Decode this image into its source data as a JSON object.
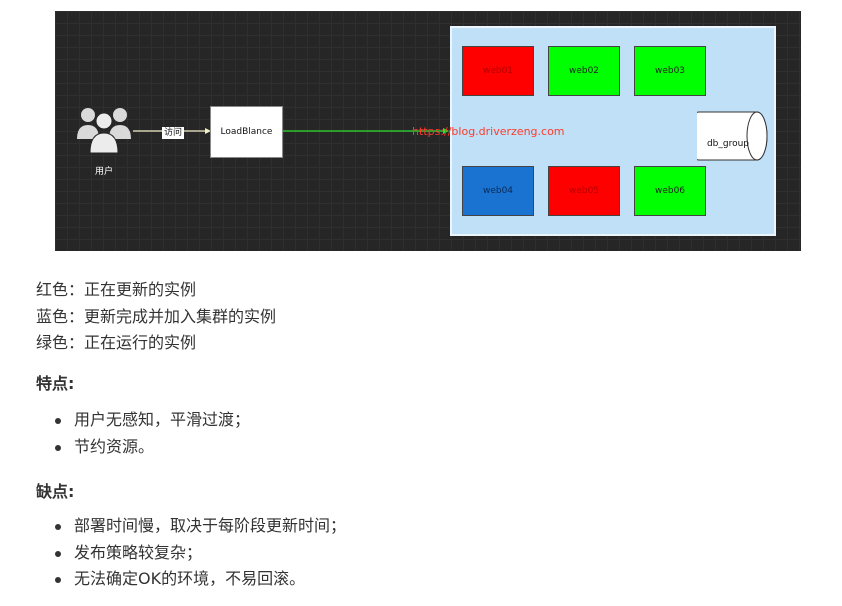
{
  "diagram": {
    "users_label": "用户",
    "visit_label": "访问",
    "loadbalancer_label": "LoadBlance",
    "url_text": "https://blog.driverzeng.com",
    "db_label": "db_group",
    "servers": [
      {
        "label": "web01",
        "color": "#ff0000"
      },
      {
        "label": "web02",
        "color": "#00ff00"
      },
      {
        "label": "web03",
        "color": "#00ff00"
      },
      {
        "label": "web04",
        "color": "#1a73d1"
      },
      {
        "label": "web05",
        "color": "#ff0000"
      },
      {
        "label": "web06",
        "color": "#00ff00"
      }
    ]
  },
  "legend": [
    "红色：正在更新的实例",
    "蓝色：更新完成并加入集群的实例",
    "绿色：正在运行的实例"
  ],
  "pros": {
    "title": "特点:",
    "items": [
      "用户无感知，平滑过渡；",
      "节约资源。"
    ]
  },
  "cons": {
    "title": "缺点:",
    "items": [
      "部署时间慢，取决于每阶段更新时间；",
      "发布策略较复杂；",
      "无法确定OK的环境，不易回滚。"
    ]
  }
}
